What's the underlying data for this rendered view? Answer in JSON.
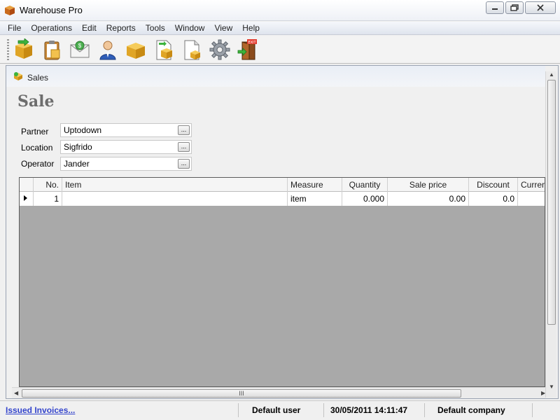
{
  "window": {
    "title": "Warehouse Pro"
  },
  "menu": [
    "File",
    "Operations",
    "Edit",
    "Reports",
    "Tools",
    "Window",
    "View",
    "Help"
  ],
  "toolbar": {
    "icons": [
      "box-green-arrow-icon",
      "clipboard-icon",
      "envelope-icon",
      "user-icon",
      "box-icon",
      "document-box-icon",
      "document-icon",
      "gear-icon",
      "exit-door-icon"
    ]
  },
  "child_window": {
    "tab_label": "Sales",
    "heading": "Sale"
  },
  "form": {
    "partner": {
      "label": "Partner",
      "value": "Uptodown"
    },
    "location": {
      "label": "Location",
      "value": "Sigfrido"
    },
    "operator": {
      "label": "Operator",
      "value": "Jander"
    },
    "browse_label": "..."
  },
  "grid": {
    "columns": [
      "",
      "No.",
      "Item",
      "Measure",
      "Quantity",
      "Sale price",
      "Discount",
      "Currency"
    ],
    "rows": [
      {
        "no": "1",
        "item": "",
        "measure": "item",
        "quantity": "0.000",
        "sale_price": "0.00",
        "discount": "0.0",
        "currency": ""
      }
    ],
    "hscroll_grip": "III"
  },
  "status": {
    "link": "Issued Invoices...",
    "user": "Default user",
    "datetime": "30/05/2011 14:11:47",
    "company": "Default company"
  }
}
